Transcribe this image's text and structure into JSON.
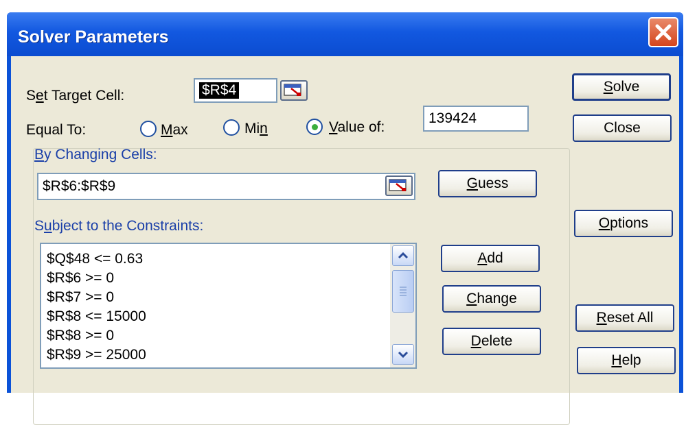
{
  "window": {
    "title": "Solver Parameters"
  },
  "target": {
    "label_pre": "S",
    "label_ul": "e",
    "label_post": "t Target Cell:",
    "value": "$R$4"
  },
  "equal_to": {
    "label": "Equal To:",
    "max": {
      "pre": "",
      "ul": "M",
      "post": "ax"
    },
    "min": {
      "pre": "Mi",
      "ul": "n",
      "post": ""
    },
    "value_of": {
      "pre": "",
      "ul": "V",
      "post": "alue of:"
    },
    "selected": "value_of",
    "value": "139424"
  },
  "changing": {
    "label_pre": "",
    "label_ul": "B",
    "label_post": "y Changing Cells:",
    "value": "$R$6:$R$9"
  },
  "constraints": {
    "label_pre": "S",
    "label_ul": "u",
    "label_post": "bject to the Constraints:",
    "items": [
      "$Q$48 <= 0.63",
      "$R$6 >= 0",
      "$R$7 >= 0",
      "$R$8 <= 15000",
      "$R$8 >= 0",
      "$R$9 >= 25000"
    ]
  },
  "buttons": {
    "solve": {
      "ul": "S",
      "post": "olve"
    },
    "close": "Close",
    "guess": {
      "ul": "G",
      "post": "uess"
    },
    "options": {
      "ul": "O",
      "post": "ptions"
    },
    "add": {
      "ul": "A",
      "post": "dd"
    },
    "change": {
      "ul": "C",
      "post": "hange"
    },
    "delete": {
      "ul": "D",
      "post": "elete"
    },
    "reset_all": {
      "ul": "R",
      "post": "eset All"
    },
    "help": {
      "ul": "H",
      "post": "elp"
    }
  },
  "colors": {
    "title_bar": "#1258e0",
    "client_bg": "#ece9d8",
    "close_button": "#d4451c",
    "selected_radio": "#3cae3c"
  }
}
